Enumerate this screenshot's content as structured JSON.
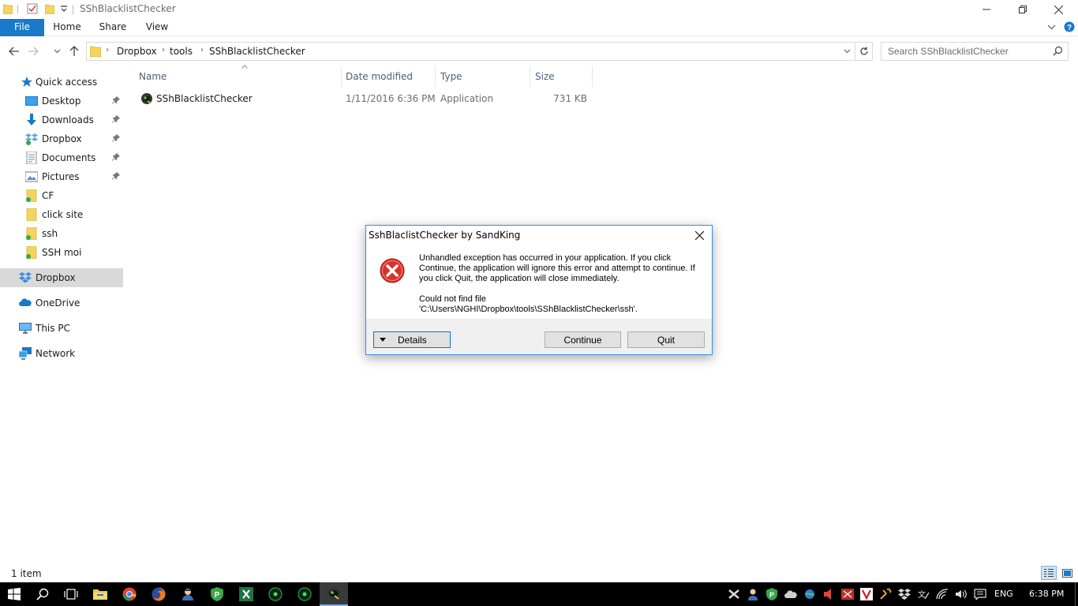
{
  "window": {
    "title": "SShBlacklistChecker",
    "ribbon_tabs": [
      "File",
      "Home",
      "Share",
      "View"
    ]
  },
  "address": {
    "crumbs": [
      "Dropbox",
      "tools",
      "SShBlacklistChecker"
    ],
    "search_placeholder": "Search SShBlacklistChecker"
  },
  "sidebar": {
    "items": [
      {
        "label": "Quick access",
        "icon": "star-icon",
        "pinned": false
      },
      {
        "label": "Desktop",
        "icon": "desktop-icon",
        "pinned": true
      },
      {
        "label": "Downloads",
        "icon": "download-arrow-icon",
        "pinned": true
      },
      {
        "label": "Dropbox",
        "icon": "dropbox-icon",
        "pinned": true
      },
      {
        "label": "Documents",
        "icon": "documents-icon",
        "pinned": true
      },
      {
        "label": "Pictures",
        "icon": "pictures-icon",
        "pinned": true
      },
      {
        "label": "CF",
        "icon": "folder-icon",
        "pinned": false
      },
      {
        "label": "click site",
        "icon": "folder-icon",
        "pinned": false
      },
      {
        "label": "ssh",
        "icon": "folder-icon",
        "pinned": false
      },
      {
        "label": "SSH moi",
        "icon": "folder-icon",
        "pinned": false
      },
      {
        "label": "Dropbox",
        "icon": "dropbox-icon",
        "pinned": false
      },
      {
        "label": "OneDrive",
        "icon": "onedrive-icon",
        "pinned": false
      },
      {
        "label": "This PC",
        "icon": "computer-icon",
        "pinned": false
      },
      {
        "label": "Network",
        "icon": "network-icon",
        "pinned": false
      }
    ]
  },
  "filelist": {
    "columns": [
      "Name",
      "Date modified",
      "Type",
      "Size"
    ],
    "rows": [
      {
        "name": "SShBlacklistChecker",
        "date": "1/11/2016 6:36 PM",
        "type": "Application",
        "size": "731 KB"
      }
    ]
  },
  "status": {
    "count": "1 item"
  },
  "dialog": {
    "title": "SshBlaclistChecker by SandKing",
    "message": "Unhandled exception has occurred in your application. If you click Continue, the application will ignore this error and attempt to continue. If you click Quit, the application will close immediately.",
    "detail_line1": "Could not find file",
    "detail_line2": "'C:\\Users\\NGHI\\Dropbox\\tools\\SShBlacklistChecker\\ssh'.",
    "details_label": "Details",
    "continue_label": "Continue",
    "quit_label": "Quit"
  },
  "taskbar": {
    "language": "ENG",
    "time": "6:38 PM"
  },
  "colors": {
    "accent": "#1979ca",
    "selection": "#d9d9d9",
    "error_red": "#d9312a",
    "folder_yellow": "#f4d35e",
    "taskbar": "#000000"
  }
}
